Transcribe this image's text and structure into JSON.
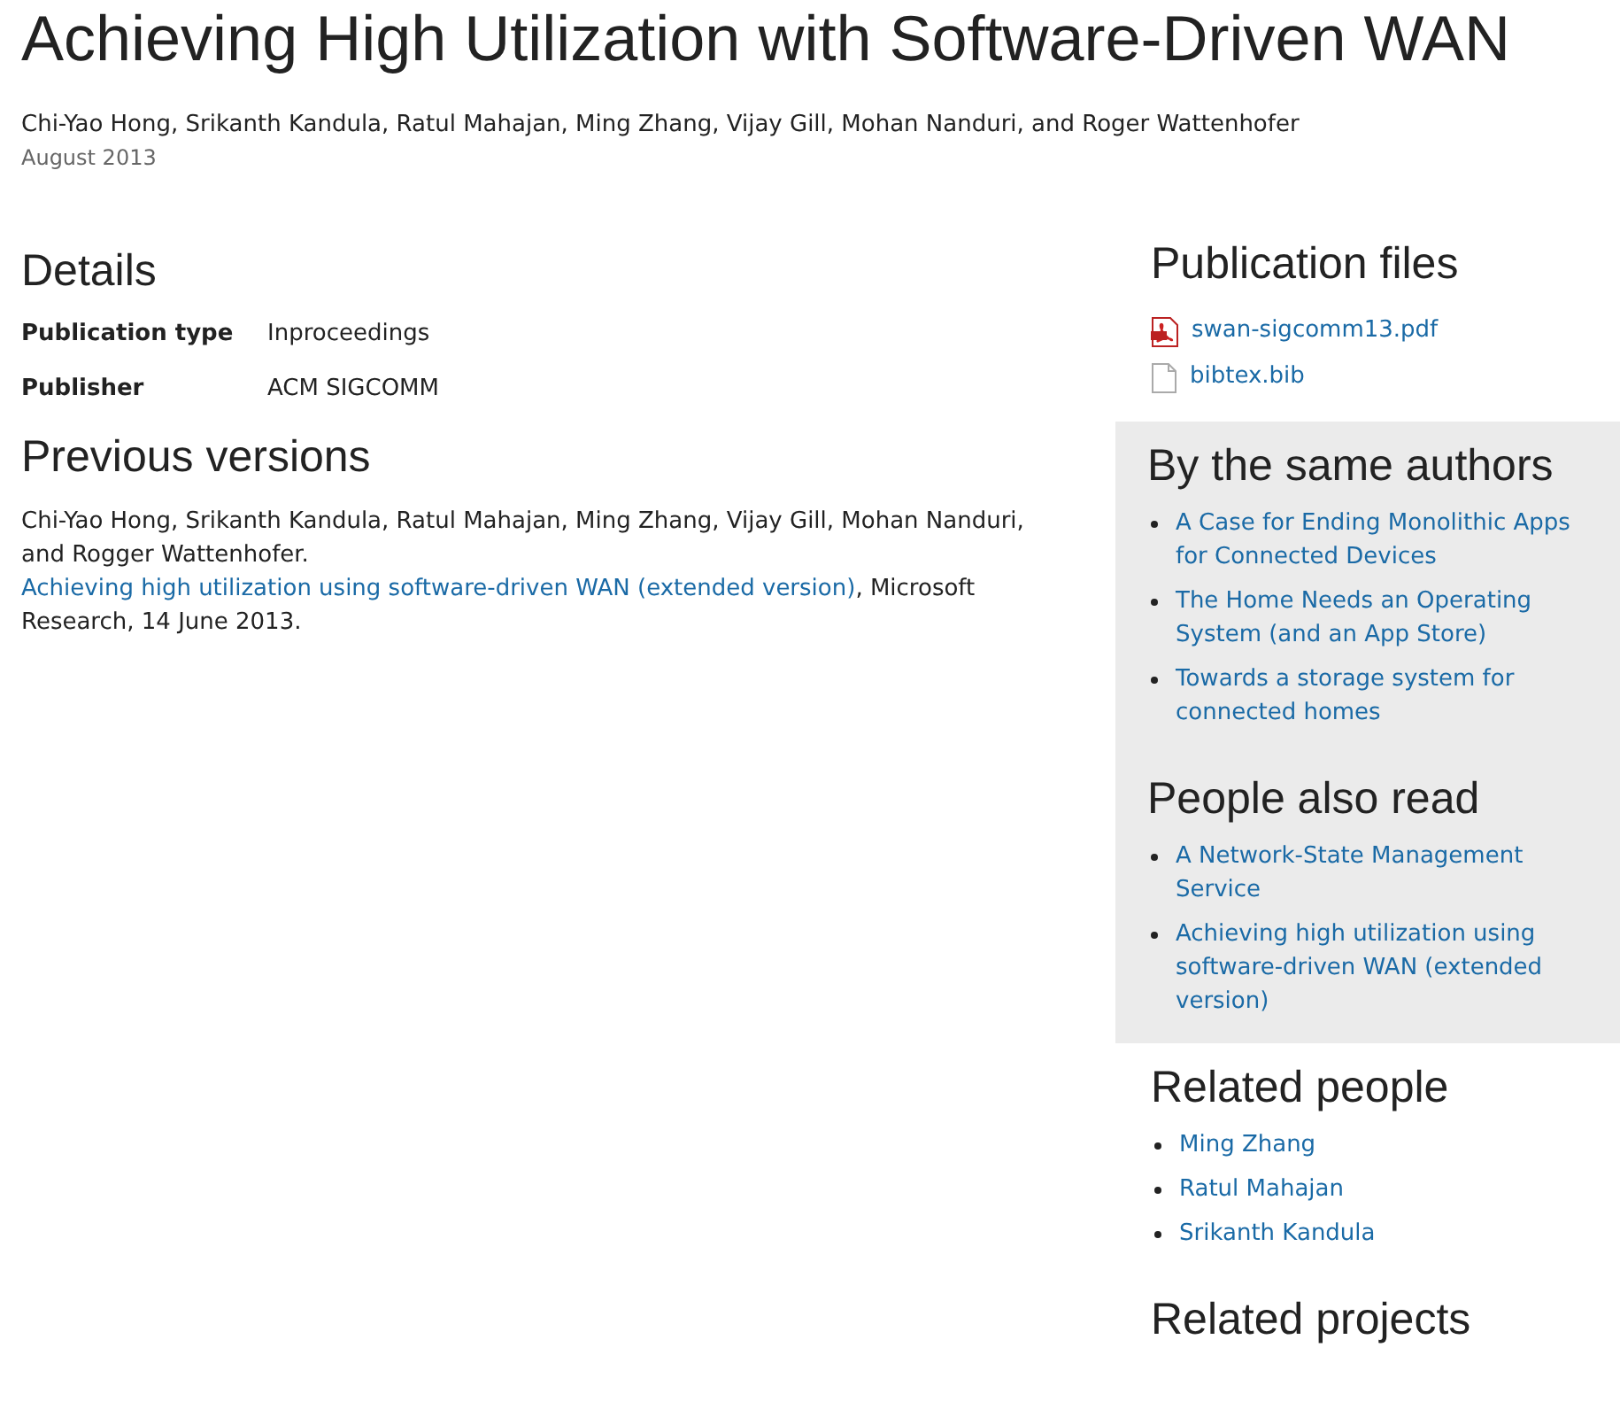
{
  "title": "Achieving High Utilization with Software-Driven WAN",
  "authors": "Chi-Yao Hong, Srikanth Kandula, Ratul Mahajan, Ming Zhang, Vijay Gill, Mohan Nanduri, and Roger Wattenhofer",
  "date": "August 2013",
  "details": {
    "heading": "Details",
    "rows": [
      {
        "label": "Publication type",
        "value": "Inproceedings"
      },
      {
        "label": "Publisher",
        "value": "ACM SIGCOMM"
      }
    ]
  },
  "previous_versions": {
    "heading": "Previous versions",
    "before": "Chi-Yao Hong, Srikanth Kandula, Ratul Mahajan, Ming Zhang, Vijay Gill, Mohan Nanduri, and Rogger Wattenhofer.",
    "link": "Achieving high utilization using software-driven WAN (extended version)",
    "after": ", Microsoft Research, 14 June 2013."
  },
  "sidebar": [
    {
      "kind": "files",
      "heading": "Publication files",
      "shaded": false,
      "items": [
        {
          "label": "swan-sigcomm13.pdf",
          "kind": "pdf"
        },
        {
          "label": "bibtex.bib",
          "kind": "file"
        }
      ]
    },
    {
      "kind": "list",
      "heading": "By the same authors",
      "shaded": true,
      "items": [
        {
          "label": "A Case for Ending Monolithic Apps for Connected Devices"
        },
        {
          "label": "The Home Needs an Operating System (and an App Store)"
        },
        {
          "label": "Towards a storage system for connected homes"
        }
      ]
    },
    {
      "kind": "list",
      "heading": "People also read",
      "shaded": true,
      "items": [
        {
          "label": "A Network-State Management Service"
        },
        {
          "label": "Achieving high utilization using software-driven WAN (extended version)"
        }
      ]
    },
    {
      "kind": "list",
      "heading": "Related people",
      "shaded": false,
      "items": [
        {
          "label": "Ming Zhang"
        },
        {
          "label": "Ratul Mahajan"
        },
        {
          "label": "Srikanth Kandula"
        }
      ]
    },
    {
      "kind": "list",
      "heading": "Related projects",
      "shaded": false
    }
  ]
}
